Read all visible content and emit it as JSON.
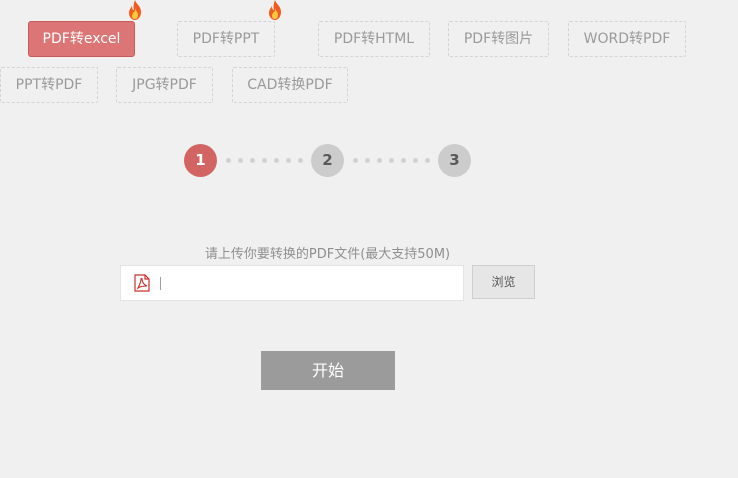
{
  "tabs": [
    {
      "label": "PDF转excel",
      "active": true,
      "hot": true
    },
    {
      "label": "PDF转PPT",
      "active": false,
      "hot": true
    },
    {
      "label": "PDF转HTML",
      "active": false,
      "hot": false
    },
    {
      "label": "PDF转图片",
      "active": false,
      "hot": false
    },
    {
      "label": "WORD转PDF",
      "active": false,
      "hot": false
    },
    {
      "label": "PPT转PDF",
      "active": false,
      "hot": false
    },
    {
      "label": "JPG转PDF",
      "active": false,
      "hot": false
    },
    {
      "label": "CAD转换PDF",
      "active": false,
      "hot": false
    }
  ],
  "steps": {
    "items": [
      "1",
      "2",
      "3"
    ],
    "current": 1
  },
  "upload": {
    "hint": "请上传你要转换的PDF文件(最大支持50M)",
    "file_value": "",
    "browse_label": "浏览"
  },
  "start_label": "开始",
  "colors": {
    "accent": "#dc7575",
    "step_active": "#d26464",
    "step_inactive": "#cccccc",
    "start_button": "#9b9b9b",
    "pdf_icon": "#c9302c",
    "flame_outer": "#f25a1f",
    "flame_inner": "#ffc73a"
  },
  "icons": {
    "hot": "fire-icon",
    "file": "pdf-file-icon"
  }
}
